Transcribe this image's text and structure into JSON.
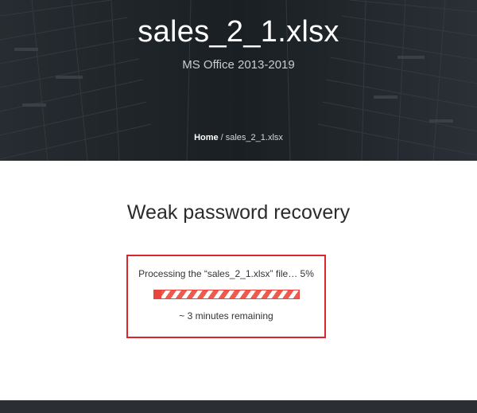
{
  "hero": {
    "title": "sales_2_1.xlsx",
    "subtitle": "MS Office 2013-2019",
    "breadcrumb": {
      "home_label": "Home",
      "separator": "/",
      "current": "sales_2_1.xlsx"
    }
  },
  "main": {
    "heading": "Weak password recovery",
    "progress": {
      "message": "Processing the “sales_2_1.xlsx” file… 5%",
      "percent": 5,
      "remaining": "~ 3 minutes remaining"
    }
  },
  "colors": {
    "hero_background": "#1d2226",
    "accent_red": "#d9262b",
    "progress_red": "#e7463c",
    "footer": "#2b2f33"
  }
}
